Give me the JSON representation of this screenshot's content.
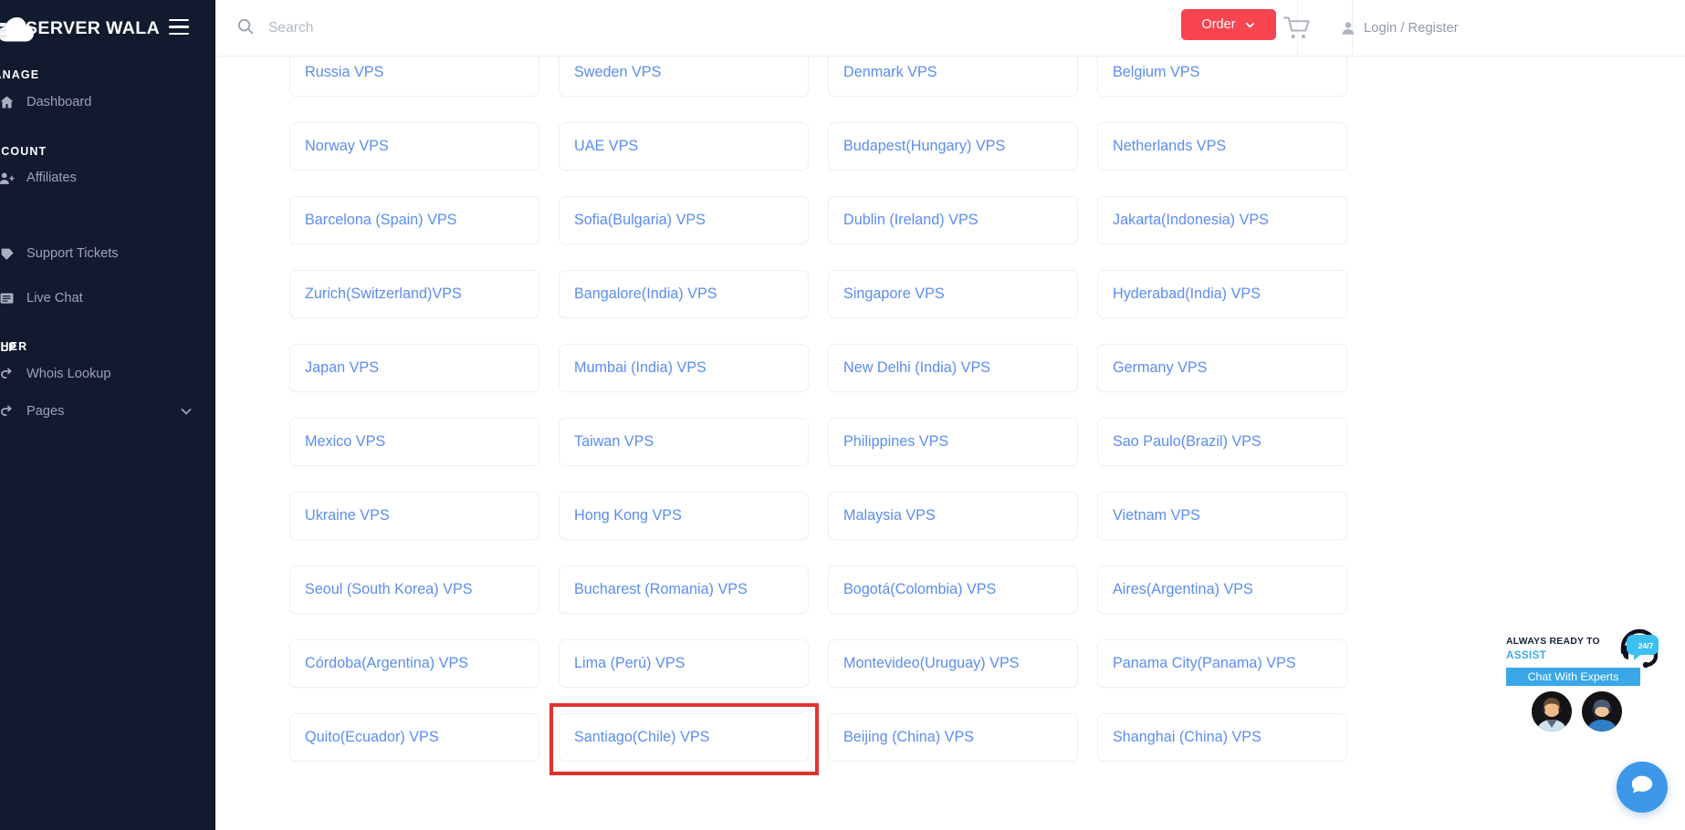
{
  "sidebar": {
    "brand": "SERVER WALA",
    "sections": [
      {
        "label": "MANAGE"
      },
      {
        "label": "ACCOUNT"
      },
      {
        "label": "HELP"
      },
      {
        "label": "OTHER"
      }
    ],
    "items": [
      {
        "label": "Dashboard",
        "icon": "home-icon"
      },
      {
        "label": "Affiliates",
        "icon": "user-plus-icon"
      },
      {
        "label": "Support Tickets",
        "icon": "ticket-icon"
      },
      {
        "label": "Live Chat",
        "icon": "chat-lines-icon"
      },
      {
        "label": "Whois Lookup",
        "icon": "lookup-icon"
      },
      {
        "label": "Pages",
        "icon": "pages-icon",
        "expandable": true
      }
    ]
  },
  "header": {
    "search_placeholder": "Search",
    "search_value": "",
    "order_label": "Order",
    "account_label": "Login / Register",
    "accent_color": "#f8444f"
  },
  "main": {
    "link_color": "#5b8def",
    "columns": 4,
    "cards": [
      "Russia VPS",
      "Sweden VPS",
      "Denmark VPS",
      "Belgium VPS",
      "Norway VPS",
      "UAE VPS",
      "Budapest(Hungary) VPS",
      "Netherlands VPS",
      "Barcelona (Spain) VPS",
      "Sofia(Bulgaria) VPS",
      "Dublin (Ireland) VPS",
      "Jakarta(Indonesia) VPS",
      "Zurich(Switzerland)VPS",
      "Bangalore(India) VPS",
      "Singapore VPS",
      "Hyderabad(India) VPS",
      "Japan VPS",
      "Mumbai (India) VPS",
      "New Delhi (India) VPS",
      "Germany VPS",
      "Mexico VPS",
      "Taiwan VPS",
      "Philippines VPS",
      "Sao Paulo(Brazil) VPS",
      "Ukraine VPS",
      "Hong Kong VPS",
      "Malaysia VPS",
      "Vietnam VPS",
      "Seoul (South Korea) VPS",
      "Bucharest (Romania) VPS",
      "Bogotá(Colombia) VPS",
      "Aires(Argentina) VPS",
      "Córdoba(Argentina) VPS",
      "Lima (Perú) VPS",
      "Montevideo(Uruguay) VPS",
      "Panama City(Panama) VPS",
      "Quito(Ecuador) VPS",
      "Santiago(Chile) VPS",
      "Beijing (China) VPS",
      "Shanghai (China) VPS"
    ],
    "highlighted_card": "Santiago(Chile) VPS",
    "highlight_color": "#e03131"
  },
  "chat_widget": {
    "ready_line1": "ALWAYS READY TO",
    "ready_line2": "ASSIST",
    "badge_text": "24/7",
    "experts_button": "Chat With Experts",
    "accent_color": "#3aa8e8"
  }
}
